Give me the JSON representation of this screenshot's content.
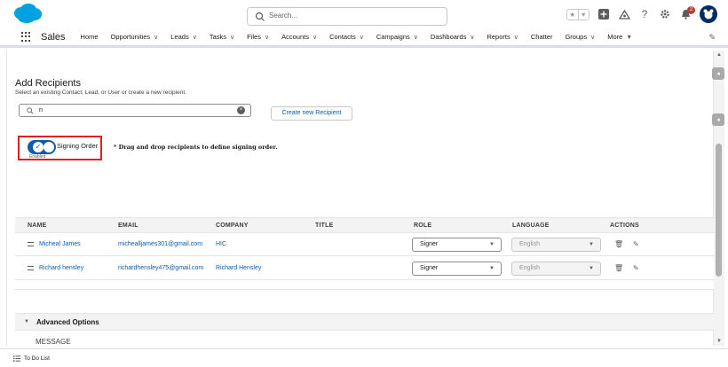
{
  "header": {
    "search_placeholder": "Search...",
    "notification_count": "2",
    "icons": [
      "favorites-star-icon",
      "favorites-list-icon",
      "global-actions-icon",
      "trailhead-icon",
      "help-icon",
      "setup-gear-icon",
      "notifications-bell-icon",
      "user-avatar-icon"
    ]
  },
  "nav": {
    "app_name": "Sales",
    "items": [
      "Home",
      "Opportunities",
      "Leads",
      "Tasks",
      "Files",
      "Accounts",
      "Contacts",
      "Campaigns",
      "Dashboards",
      "Reports",
      "Chatter",
      "Groups",
      "More"
    ]
  },
  "recipients": {
    "title": "Add Recipients",
    "subtitle": "Select an existing Contact, Lead, or User or create a new recipient.",
    "search_value": "ri",
    "create_button": "Create new Recipient",
    "signing_order_label": "Signing Order",
    "signing_order_state": "Enabled",
    "drag_note": "* Drag and drop recipients to define signing order."
  },
  "table": {
    "headers": [
      "NAME",
      "EMAIL",
      "COMPANY",
      "TITLE",
      "ROLE",
      "LANGUAGE",
      "ACTIONS"
    ],
    "rows": [
      {
        "name": "Micheal James",
        "email": "michealljames301@gmail.com",
        "company": "HIC",
        "title": "",
        "role": "Signer",
        "language": "English"
      },
      {
        "name": "Richard hensley",
        "email": "richardhensley475@gmail.com",
        "company": "Richard Hensley",
        "title": "",
        "role": "Signer",
        "language": "English"
      }
    ]
  },
  "advanced": {
    "label": "Advanced Options",
    "message_label": "MESSAGE"
  },
  "footer": {
    "todo_label": "To Do List"
  },
  "colors": {
    "brand_blue": "#0b5cab",
    "salesforce_cloud": "#00a1e0",
    "highlight_red": "#e0201e"
  }
}
